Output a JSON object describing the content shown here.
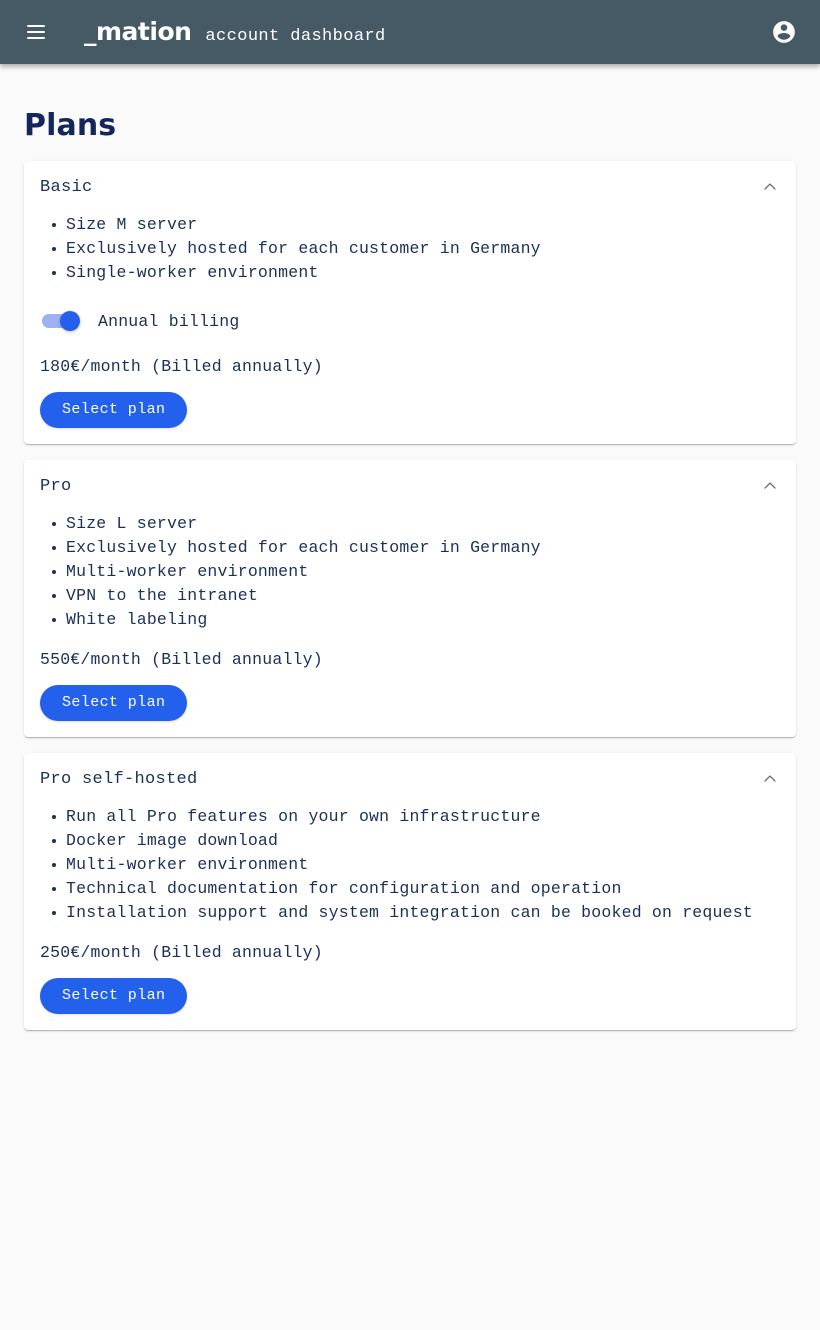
{
  "header": {
    "menu_icon": "hamburger-menu-icon",
    "logo_text": "_mation",
    "subtitle": "account dashboard",
    "account_icon": "account-circle-icon",
    "background_color": "#455a64"
  },
  "page": {
    "title": "Plans",
    "title_color": "#14275c",
    "background_color": "#fafafa"
  },
  "theme": {
    "accent_blue": "#2360ec",
    "toggle_track": "#9db1f3",
    "text_navy": "#1b3058",
    "card_background": "#ffffff"
  },
  "plans": [
    {
      "name": "Basic",
      "collapse_icon": "chevron-up-icon",
      "features": [
        "Size M server",
        "Exclusively hosted for each customer in Germany",
        "Single-worker environment"
      ],
      "toggle": {
        "label": "Annual billing",
        "checked": true
      },
      "price": "180€/month (Billed annually)",
      "button_label": "Select plan"
    },
    {
      "name": "Pro",
      "collapse_icon": "chevron-up-icon",
      "features": [
        "Size L server",
        "Exclusively hosted for each customer in Germany",
        "Multi-worker environment",
        "VPN to the intranet",
        "White labeling"
      ],
      "price": "550€/month (Billed annually)",
      "button_label": "Select plan"
    },
    {
      "name": "Pro self-hosted",
      "collapse_icon": "chevron-up-icon",
      "features": [
        "Run all Pro features on your own infrastructure",
        "Docker image download",
        "Multi-worker environment",
        "Technical documentation for configuration and operation",
        "Installation support and system integration can be booked on request"
      ],
      "price": "250€/month (Billed annually)",
      "button_label": "Select plan"
    }
  ]
}
